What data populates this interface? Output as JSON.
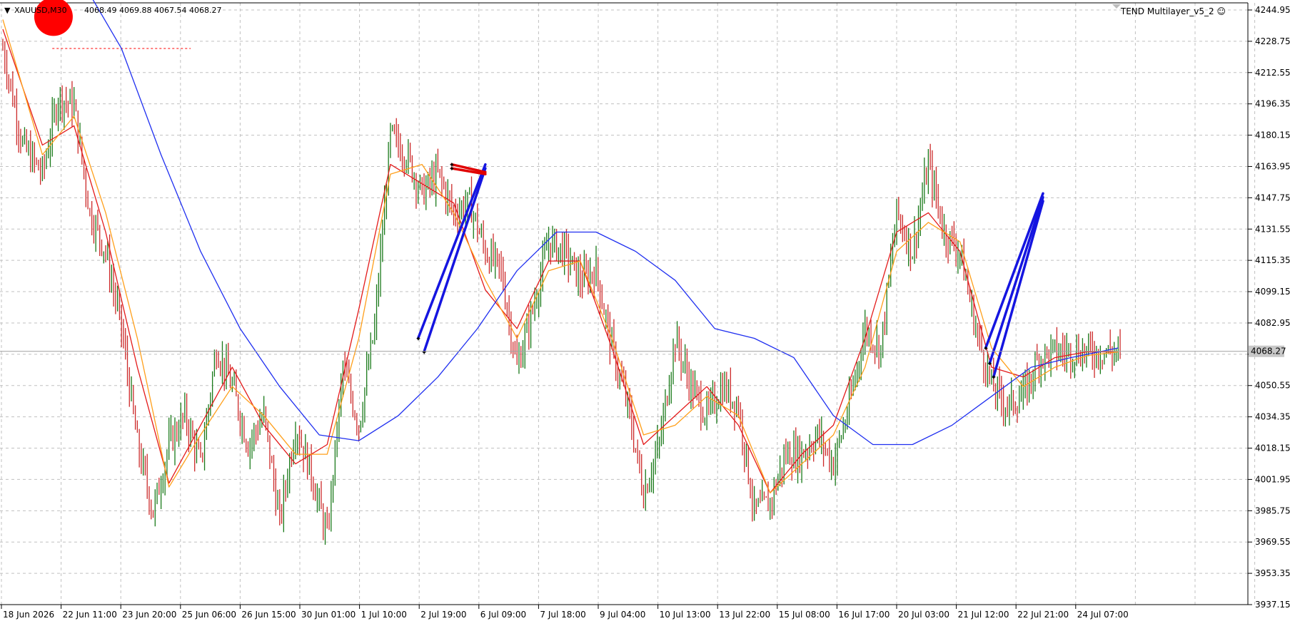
{
  "header": {
    "symbol": "XAUUSD,M30",
    "ohlc": "4068.49 4069.88 4067.54 4068.27",
    "indicator": "TEND Multilayer_v5_2",
    "indicator_glyph": "☺",
    "triangle_glyph": "▼"
  },
  "colors": {
    "background": "#ffffff",
    "grid": "#c0c0c0",
    "bull_candle": "#1a7a1a",
    "bear_candle": "#cc2a2a",
    "ma_fast": "#e31a1a",
    "ma_mid": "#ff9f1a",
    "ma_slow": "#1f2ff0",
    "signal_up": "#1515e0",
    "signal_down": "#e00000",
    "price_tag_bg": "#c8c8c8",
    "marker": "#ff0000"
  },
  "chart_data": {
    "type": "line",
    "title": "",
    "instrument": "XAUUSD,M30",
    "grid": true,
    "price_axis": "right",
    "ylim": [
      3937.15,
      4244.95
    ],
    "y_ticks": [
      4244.95,
      4228.75,
      4212.55,
      4196.35,
      4180.15,
      4163.95,
      4147.75,
      4131.55,
      4115.35,
      4099.15,
      4082.95,
      4066.75,
      4050.55,
      4034.35,
      4018.15,
      4001.95,
      3985.75,
      3969.55,
      3953.35,
      3937.15
    ],
    "y_tick_labels": [
      "4244.95",
      "4228.75",
      "4212.55",
      "4196.35",
      "4180.15",
      "4163.95",
      "4147.75",
      "4131.55",
      "4115.35",
      "4099.15",
      "4082.95",
      "",
      "4050.55",
      "4034.35",
      "4018.15",
      "4001.95",
      "3985.75",
      "3969.55",
      "3953.35",
      "3937.15"
    ],
    "x_tick_labels": [
      "18 Jun 2026",
      "22 Jun 11:00",
      "23 Jun 20:00",
      "25 Jun 06:00",
      "26 Jun 15:00",
      "30 Jun 01:00",
      "1 Jul 10:00",
      "2 Jul 19:00",
      "6 Jul 09:00",
      "7 Jul 18:00",
      "9 Jul 04:00",
      "10 Jul 13:00",
      "13 Jul 22:00",
      "15 Jul 08:00",
      "16 Jul 17:00",
      "20 Jul 03:00",
      "21 Jul 12:00",
      "22 Jul 21:00",
      "24 Jul 07:00"
    ],
    "current_price": 4068.27,
    "current_price_label": "4068.27",
    "price_path": {
      "bars": [
        0,
        10,
        20,
        28,
        36,
        44,
        52,
        60,
        68,
        76,
        84,
        92,
        100,
        108,
        116,
        124,
        132,
        140,
        148,
        156,
        164,
        172,
        180,
        188,
        196,
        204,
        212,
        220,
        228,
        236,
        244,
        252,
        260,
        268,
        276,
        284,
        292,
        300,
        308,
        316,
        324,
        332,
        340,
        348,
        356,
        364,
        372,
        380,
        388,
        396,
        404,
        412,
        420,
        428,
        436,
        444,
        452,
        460,
        468,
        476,
        484,
        492,
        500,
        508,
        516,
        524,
        532,
        540,
        548,
        556,
        564
      ],
      "prices": [
        4225,
        4175,
        4160,
        4200,
        4195,
        4140,
        4120,
        4080,
        4020,
        3985,
        4020,
        4035,
        4010,
        4070,
        4050,
        4020,
        4035,
        3980,
        4030,
        4005,
        3972,
        4060,
        4030,
        4080,
        4180,
        4170,
        4150,
        4160,
        4140,
        4145,
        4120,
        4110,
        4060,
        4090,
        4125,
        4120,
        4105,
        4110,
        4070,
        4040,
        3995,
        4020,
        4075,
        4050,
        4035,
        4050,
        4040,
        3985,
        3990,
        4015,
        4015,
        4025,
        4010,
        4040,
        4080,
        4070,
        4140,
        4120,
        4165,
        4130,
        4120,
        4080,
        4050,
        4040,
        4045,
        4065,
        4068,
        4068,
        4068,
        4068,
        4068
      ]
    },
    "bars_total": 566,
    "visible_bars": 566,
    "series": [
      {
        "name": "",
        "color": "#e31a1a",
        "bars": [
          0,
          20,
          36,
          52,
          68,
          84,
          100,
          116,
          132,
          148,
          164,
          180,
          196,
          212,
          228,
          244,
          260,
          276,
          292,
          308,
          324,
          340,
          356,
          372,
          388,
          404,
          420,
          436,
          452,
          468,
          484,
          500,
          516,
          532,
          548,
          564
        ],
        "values": [
          4235,
          4175,
          4185,
          4130,
          4060,
          4000,
          4030,
          4060,
          4030,
          4010,
          4020,
          4090,
          4165,
          4155,
          4145,
          4100,
          4080,
          4115,
          4115,
          4070,
          4020,
          4035,
          4050,
          4030,
          3995,
          4015,
          4030,
          4075,
          4130,
          4140,
          4120,
          4060,
          4055,
          4065,
          4068,
          4068
        ]
      },
      {
        "name": "",
        "color": "#ff9f1a",
        "bars": [
          0,
          20,
          36,
          52,
          68,
          84,
          100,
          116,
          132,
          148,
          164,
          180,
          196,
          212,
          228,
          244,
          260,
          276,
          292,
          308,
          324,
          340,
          356,
          372,
          388,
          404,
          420,
          436,
          452,
          468,
          484,
          500,
          516,
          532,
          548,
          564
        ],
        "values": [
          4240,
          4170,
          4190,
          4140,
          4075,
          3998,
          4025,
          4050,
          4035,
          4015,
          4015,
          4075,
          4160,
          4165,
          4140,
          4105,
          4075,
          4110,
          4115,
          4075,
          4025,
          4030,
          4045,
          4035,
          3995,
          4010,
          4025,
          4060,
          4120,
          4135,
          4125,
          4070,
          4050,
          4060,
          4066,
          4068
        ]
      },
      {
        "name": "",
        "color": "#1f2ff0",
        "bars": [
          40,
          60,
          80,
          100,
          120,
          140,
          160,
          180,
          200,
          220,
          240,
          260,
          280,
          300,
          320,
          340,
          360,
          380,
          400,
          420,
          440,
          460,
          480,
          500,
          520,
          540,
          564
        ],
        "values": [
          4260,
          4225,
          4170,
          4120,
          4080,
          4050,
          4025,
          4022,
          4035,
          4055,
          4080,
          4110,
          4130,
          4130,
          4120,
          4105,
          4080,
          4075,
          4065,
          4035,
          4020,
          4020,
          4030,
          4045,
          4060,
          4065,
          4070
        ]
      }
    ],
    "signals": [
      {
        "direction": "up",
        "from_bar": 210,
        "from_price": 4075,
        "to_bar": 244,
        "to_price": 4165
      },
      {
        "direction": "up",
        "from_bar": 213,
        "from_price": 4068,
        "to_bar": 244,
        "to_price": 4163
      },
      {
        "direction": "down",
        "from_bar": 227,
        "from_price": 4163,
        "to_bar": 244,
        "to_price": 4160
      },
      {
        "direction": "down",
        "from_bar": 227,
        "from_price": 4165,
        "to_bar": 244,
        "to_price": 4161
      },
      {
        "direction": "up",
        "from_bar": 497,
        "from_price": 4070,
        "to_bar": 526,
        "to_price": 4150
      },
      {
        "direction": "up",
        "from_bar": 499,
        "from_price": 4062,
        "to_bar": 526,
        "to_price": 4148
      },
      {
        "direction": "up",
        "from_bar": 501,
        "from_price": 4055,
        "to_bar": 526,
        "to_price": 4146
      }
    ],
    "level_line": {
      "price": 4225,
      "from_bar": 25,
      "to_bar": 95
    },
    "marker": {
      "type": "circle",
      "bar": 22,
      "price": 4240
    }
  }
}
